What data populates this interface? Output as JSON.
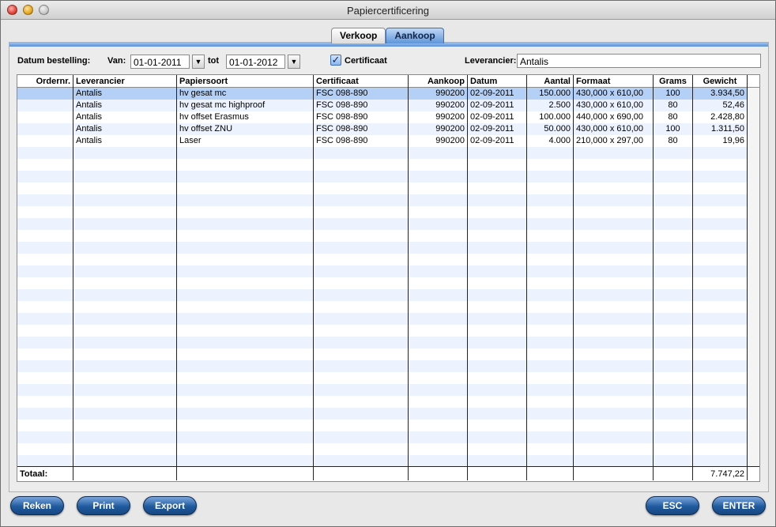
{
  "window": {
    "title": "Papiercertificering"
  },
  "tabs": [
    {
      "label": "Verkoop"
    },
    {
      "label": "Aankoop"
    }
  ],
  "filters": {
    "datum_label": "Datum bestelling:",
    "van_label": "Van:",
    "van_value": "01-01-2011",
    "tot_label": "tot",
    "tot_value": "01-01-2012",
    "certificaat_label": "Certificaat",
    "certificaat_checked": true,
    "leverancier_label": "Leverancier:",
    "leverancier_value": "Antalis"
  },
  "table": {
    "columns": [
      "Ordernr.",
      "Leverancier",
      "Papiersoort",
      "Certificaat",
      "Aankoop",
      "Datum",
      "Aantal",
      "Formaat",
      "Grams",
      "Gewicht"
    ],
    "rows": [
      [
        "",
        "Antalis",
        "hv gesat mc",
        "FSC 098-890",
        "990200",
        "02-09-2011",
        "150.000",
        "430,000 x 610,00",
        "100",
        "3.934,50"
      ],
      [
        "",
        "Antalis",
        "hv gesat mc highproof",
        "FSC 098-890",
        "990200",
        "02-09-2011",
        "2.500",
        "430,000 x 610,00",
        "80",
        "52,46"
      ],
      [
        "",
        "Antalis",
        "hv offset Erasmus",
        "FSC 098-890",
        "990200",
        "02-09-2011",
        "100.000",
        "440,000 x 690,00",
        "80",
        "2.428,80"
      ],
      [
        "",
        "Antalis",
        "hv offset ZNU",
        "FSC 098-890",
        "990200",
        "02-09-2011",
        "50.000",
        "430,000 x 610,00",
        "100",
        "1.311,50"
      ],
      [
        "",
        "Antalis",
        "Laser",
        "FSC 098-890",
        "990200",
        "02-09-2011",
        "4.000",
        "210,000 x 297,00",
        "80",
        "19,96"
      ]
    ],
    "selected_row": 0,
    "total_label": "Totaal:",
    "total_gewicht": "7.747,22"
  },
  "buttons": {
    "reken": "Reken",
    "print": "Print",
    "export": "Export",
    "esc": "ESC",
    "enter": "ENTER"
  },
  "icons": {
    "dropdown": "triangle-down-icon",
    "check": "checkmark-icon"
  }
}
